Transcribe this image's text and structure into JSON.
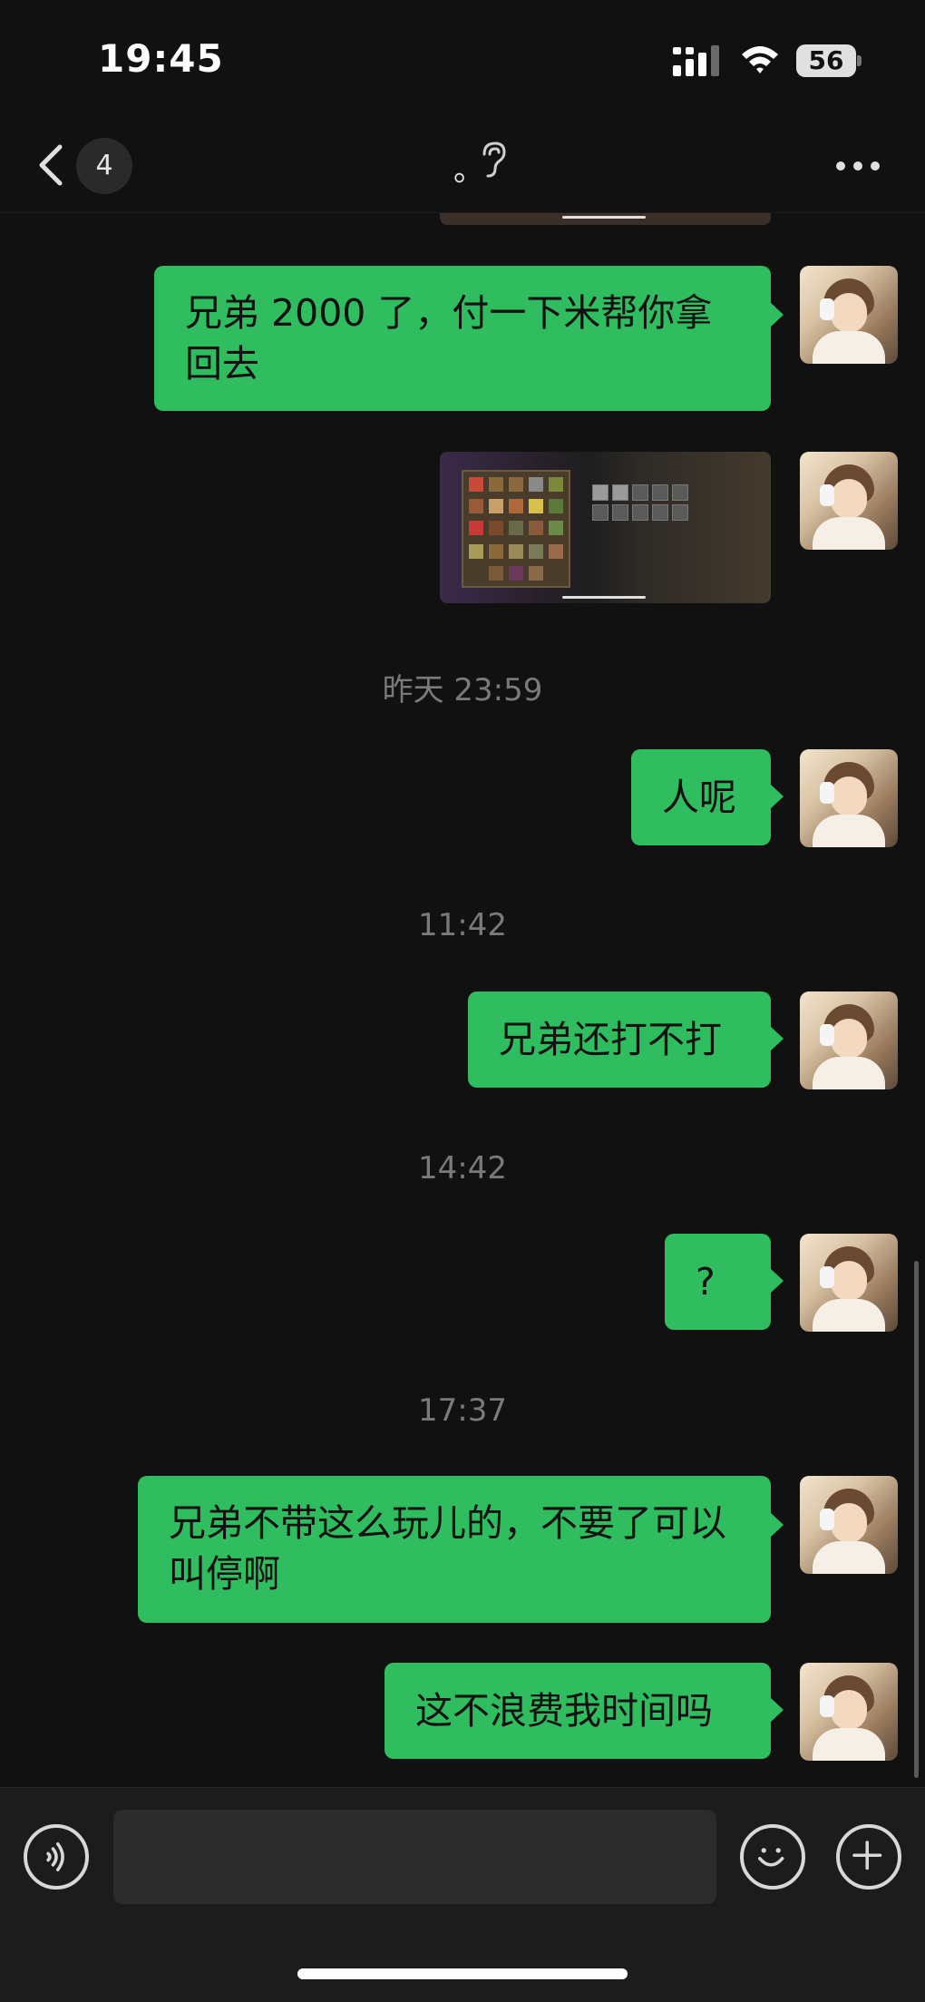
{
  "status_bar": {
    "time": "19:45",
    "battery": "56"
  },
  "header": {
    "unread_count": "4",
    "title": "。"
  },
  "messages": [
    {
      "type": "text",
      "text": "兄弟 2000 了，付一下米帮你拿回去"
    },
    {
      "type": "image"
    },
    {
      "type": "timestamp",
      "text": "昨天 23:59"
    },
    {
      "type": "text",
      "text": "人呢"
    },
    {
      "type": "timestamp",
      "text": "11:42"
    },
    {
      "type": "text",
      "text": "兄弟还打不打"
    },
    {
      "type": "timestamp",
      "text": "14:42"
    },
    {
      "type": "text",
      "text": "?"
    },
    {
      "type": "timestamp",
      "text": "17:37"
    },
    {
      "type": "text",
      "text": "兄弟不带这么玩儿的，不要了可以叫停啊"
    },
    {
      "type": "text",
      "text": "这不浪费我时间吗"
    }
  ],
  "input": {
    "value": ""
  },
  "icons": {
    "back": "chevron-left-icon",
    "earpiece": "ear-icon",
    "more": "more-dots-icon",
    "voice": "voice-icon",
    "emoji": "emoji-icon",
    "plus": "plus-icon"
  },
  "colors": {
    "bubble": "#2fbd5f",
    "background": "#111111"
  }
}
